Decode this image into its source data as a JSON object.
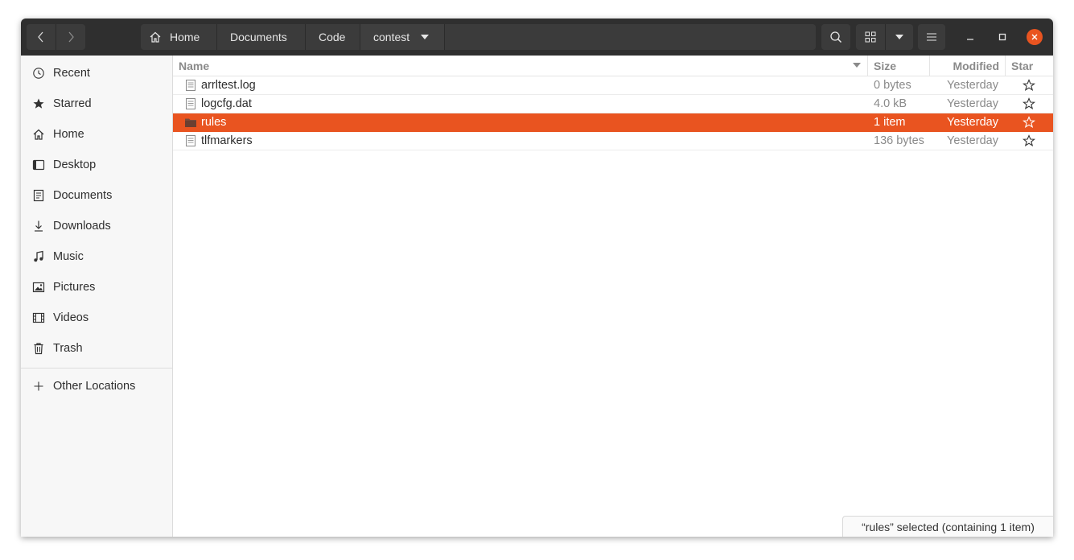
{
  "pathbar": {
    "crumbs": [
      "Home",
      "Documents",
      "Code",
      "contest"
    ]
  },
  "sidebar": {
    "items": [
      {
        "label": "Recent",
        "icon": "clock-icon"
      },
      {
        "label": "Starred",
        "icon": "star-icon"
      },
      {
        "label": "Home",
        "icon": "home-icon"
      },
      {
        "label": "Desktop",
        "icon": "desktop-icon"
      },
      {
        "label": "Documents",
        "icon": "document-icon"
      },
      {
        "label": "Downloads",
        "icon": "download-icon"
      },
      {
        "label": "Music",
        "icon": "music-icon"
      },
      {
        "label": "Pictures",
        "icon": "picture-icon"
      },
      {
        "label": "Videos",
        "icon": "video-icon"
      },
      {
        "label": "Trash",
        "icon": "trash-icon"
      }
    ],
    "other_locations": "Other Locations"
  },
  "columns": {
    "name": "Name",
    "size": "Size",
    "modified": "Modified",
    "star": "Star"
  },
  "files": [
    {
      "name": "arrltest.log",
      "size": "0 bytes",
      "modified": "Yesterday",
      "type": "file",
      "selected": false
    },
    {
      "name": "logcfg.dat",
      "size": "4.0 kB",
      "modified": "Yesterday",
      "type": "file",
      "selected": false
    },
    {
      "name": "rules",
      "size": "1 item",
      "modified": "Yesterday",
      "type": "folder",
      "selected": true
    },
    {
      "name": "tlfmarkers",
      "size": "136 bytes",
      "modified": "Yesterday",
      "type": "file",
      "selected": false
    }
  ],
  "status": "“rules” selected  (containing 1 item)",
  "colors": {
    "accent": "#e95420",
    "headerbar": "#2f2f2f",
    "sidebar": "#f7f7f7"
  }
}
